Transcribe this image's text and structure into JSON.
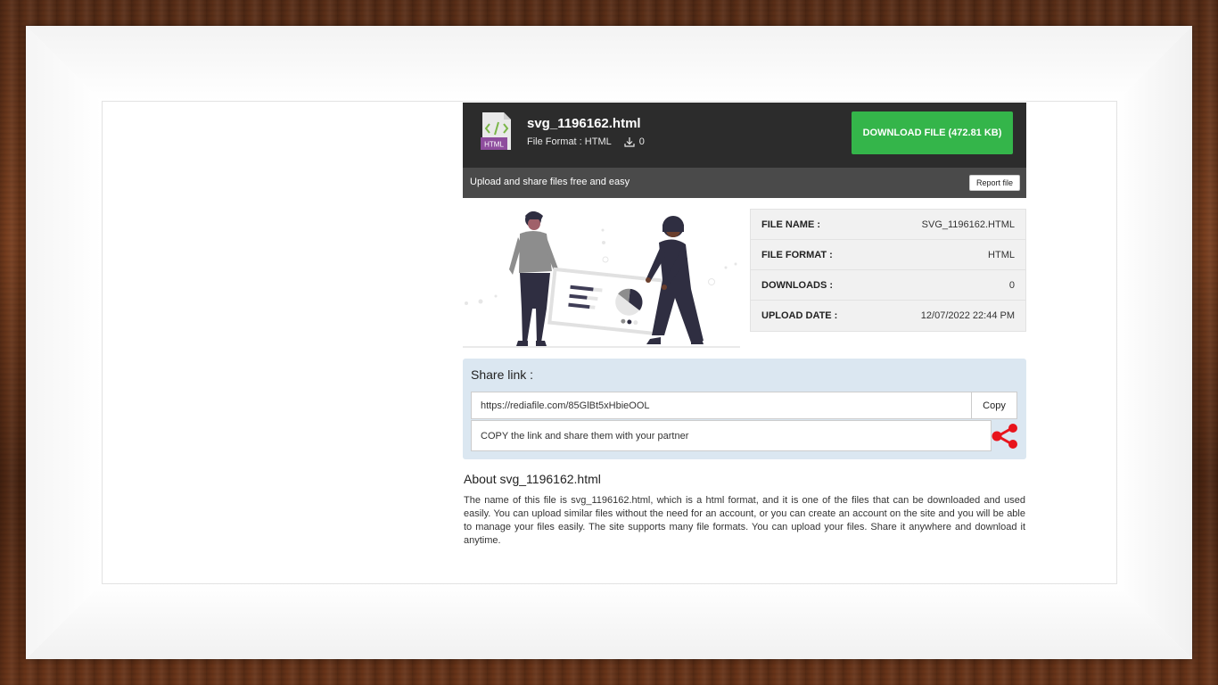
{
  "file": {
    "name": "svg_1196162.html",
    "format_line": "File Format : HTML",
    "download_count": "0",
    "icon_label": "HTML"
  },
  "download_button": "DOWNLOAD FILE (472.81 KB)",
  "tagline": "Upload and share files free and easy",
  "report_button": "Report file",
  "info": {
    "rows": [
      {
        "label": "FILE NAME :",
        "value": "SVG_1196162.HTML"
      },
      {
        "label": "FILE FORMAT :",
        "value": "HTML"
      },
      {
        "label": "DOWNLOADS :",
        "value": "0"
      },
      {
        "label": "UPLOAD DATE :",
        "value": "12/07/2022 22:44 PM"
      }
    ]
  },
  "share": {
    "title": "Share link :",
    "url": "https://rediafile.com/85GlBt5xHbieOOL",
    "copy_button": "Copy",
    "note": "COPY the link and share them with your partner"
  },
  "about": {
    "title": "About svg_1196162.html",
    "text": "The name of this file is svg_1196162.html, which is a html format, and it is one of the files that can be downloaded and used easily. You can upload similar files without the need for an account, or you can create an account on the site and you will be able to manage your files easily. The site supports many file formats. You can upload your files. Share it anywhere and download it anytime."
  },
  "colors": {
    "header_bg": "#2c2c2c",
    "subbar_bg": "#4a4a4a",
    "download_green": "#34b54a",
    "share_bg": "#dbe7f1",
    "share_icon_red": "#e8141c"
  },
  "icons": {
    "file_type": "html-file-icon",
    "downloads": "download-icon",
    "share": "share-icon"
  }
}
